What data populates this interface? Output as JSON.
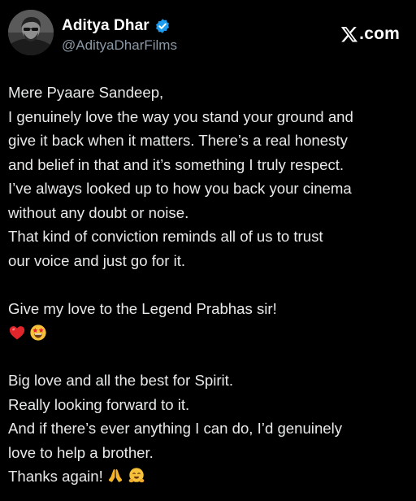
{
  "header": {
    "display_name": "Aditya Dhar",
    "handle": "@AdityaDharFilms",
    "avatar_icon": "profile-photo",
    "verified_icon": "verified-badge-icon",
    "brand_text": ".com",
    "brand_icon": "x-logo-icon"
  },
  "post": {
    "lines": [
      "Mere Pyaare Sandeep,",
      "I genuinely love the way you stand your ground and",
      "give it back when it matters. There’s a real honesty",
      "and belief in that and it’s something I truly respect.",
      "I’ve always looked up to how you back your cinema",
      "without any doubt or noise.",
      "That kind of conviction reminds all of us to trust",
      "our voice and just go for it.",
      "",
      "Give my love to the Legend Prabhas sir!",
      "",
      "",
      "Big love and all the best for Spirit.",
      "Really looking forward to it.",
      "And if there’s ever anything I can do, I’d genuinely",
      "love to help a brother.",
      "Thanks again!"
    ],
    "emoji_line": [
      "red-heart-emoji",
      "star-struck-emoji"
    ],
    "final_emojis": [
      "folded-hands-emoji",
      "hugging-face-emoji"
    ]
  },
  "colors": {
    "background": "#000000",
    "text": "#e7e9ea",
    "handle": "#8b98a5",
    "verified": "#1d9bf0"
  }
}
